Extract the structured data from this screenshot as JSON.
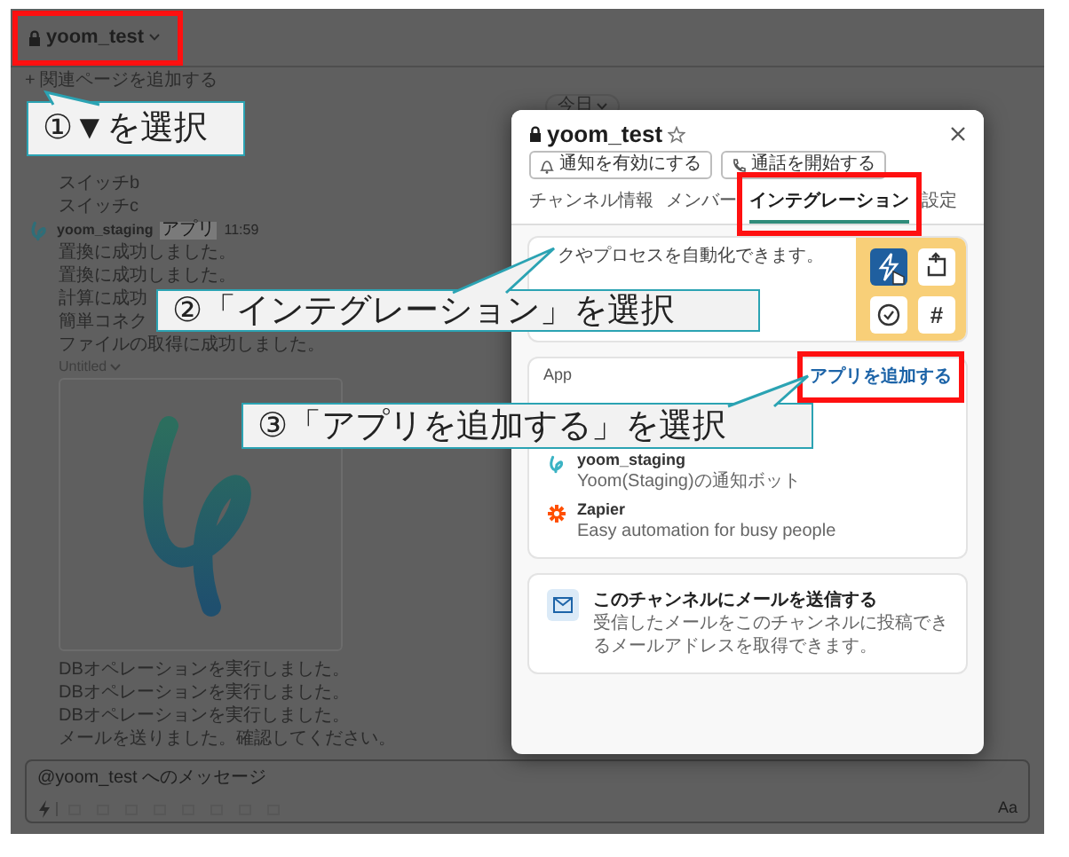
{
  "channel": {
    "title": "yoom_test",
    "add_related": "+ 関連ページを追加する",
    "date": "今日"
  },
  "messages": [
    {
      "kind": "text",
      "text": "スイッチb"
    },
    {
      "kind": "text",
      "text": "スイッチc"
    },
    {
      "kind": "sender",
      "author": "yoom_staging",
      "badge": "アプリ",
      "time": "11:59"
    },
    {
      "kind": "text",
      "text": "置換に成功しました。"
    },
    {
      "kind": "text",
      "text": "置換に成功しました。"
    },
    {
      "kind": "text",
      "text": "計算に成功"
    },
    {
      "kind": "text",
      "text": "簡単コネク"
    },
    {
      "kind": "text",
      "text": "ファイルの取得に成功しました。"
    },
    {
      "kind": "file",
      "name": "Untitled"
    },
    {
      "kind": "text",
      "text": "DBオペレーションを実行しました。"
    },
    {
      "kind": "text",
      "text": "DBオペレーションを実行しました。"
    },
    {
      "kind": "text",
      "text": "DBオペレーションを実行しました。"
    },
    {
      "kind": "text",
      "text": "メールを送りました。確認してください。"
    }
  ],
  "composer": {
    "placeholder": "@yoom_test へのメッセージ",
    "format_hint": "Aa"
  },
  "modal": {
    "title": "yoom_test",
    "buttons": [
      {
        "kind": "bell",
        "label": "通知を有効にする"
      },
      {
        "kind": "phone",
        "label": "通話を開始する"
      }
    ],
    "tabs": [
      {
        "label": "チャンネル情報",
        "selected": false
      },
      {
        "label": "メンバー",
        "selected": false
      },
      {
        "label": "インテグレーション",
        "selected": true
      },
      {
        "label": "設定",
        "selected": false
      }
    ],
    "workflow": {
      "description": "クやプロセスを自動化できます。",
      "hash": "#"
    },
    "apps": {
      "heading": "App",
      "add_link": "アプリを追加する",
      "items": [
        {
          "kind": "yoom",
          "name": "yoom_staging",
          "description": "Yoom(Staging)の通知ボット"
        },
        {
          "kind": "zapier",
          "name": "Zapier",
          "description": "Easy automation for busy people"
        }
      ]
    },
    "email": {
      "title": "このチャンネルにメールを送信する",
      "description": "受信したメールをこのチャンネルに投稿できるメールアドレスを取得できます。"
    }
  },
  "annotations": [
    {
      "text": "①▼を選択"
    },
    {
      "text": "②「インテグレーション」を選択"
    },
    {
      "text": "③「アプリを追加する」を選択"
    }
  ]
}
